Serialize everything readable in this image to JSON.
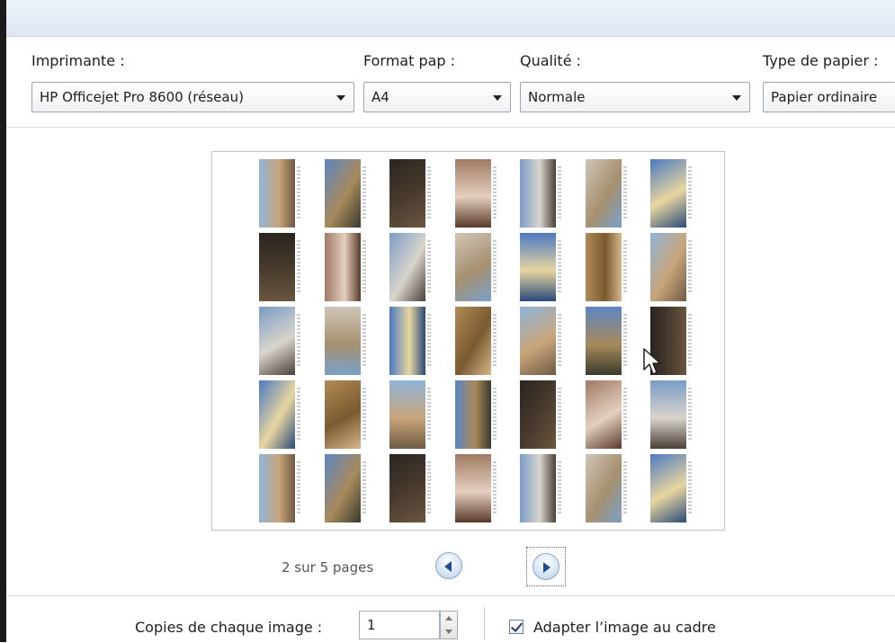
{
  "settings": {
    "printer_label": "Imprimante :",
    "printer_value": "HP Officejet Pro 8600 (réseau)",
    "format_label": "Format pap :",
    "format_value": "A4",
    "quality_label": "Qualité :",
    "quality_value": "Normale",
    "paper_type_label": "Type de papier :",
    "paper_type_value": "Papier ordinaire"
  },
  "preview": {
    "page_status": "2 sur 5 pages",
    "rows": 5,
    "cols": 7
  },
  "options": {
    "copies_label": "Copies de chaque image :",
    "copies_value": "1",
    "fit_label": "Adapter l’image au cadre",
    "fit_checked": true
  },
  "colors": {
    "accent": "#1f4f8f",
    "title_strip": "#dde7f3"
  },
  "icons": {
    "previous": "previous-page-icon",
    "next": "next-page-icon",
    "cursor": "mouse-pointer-icon"
  }
}
